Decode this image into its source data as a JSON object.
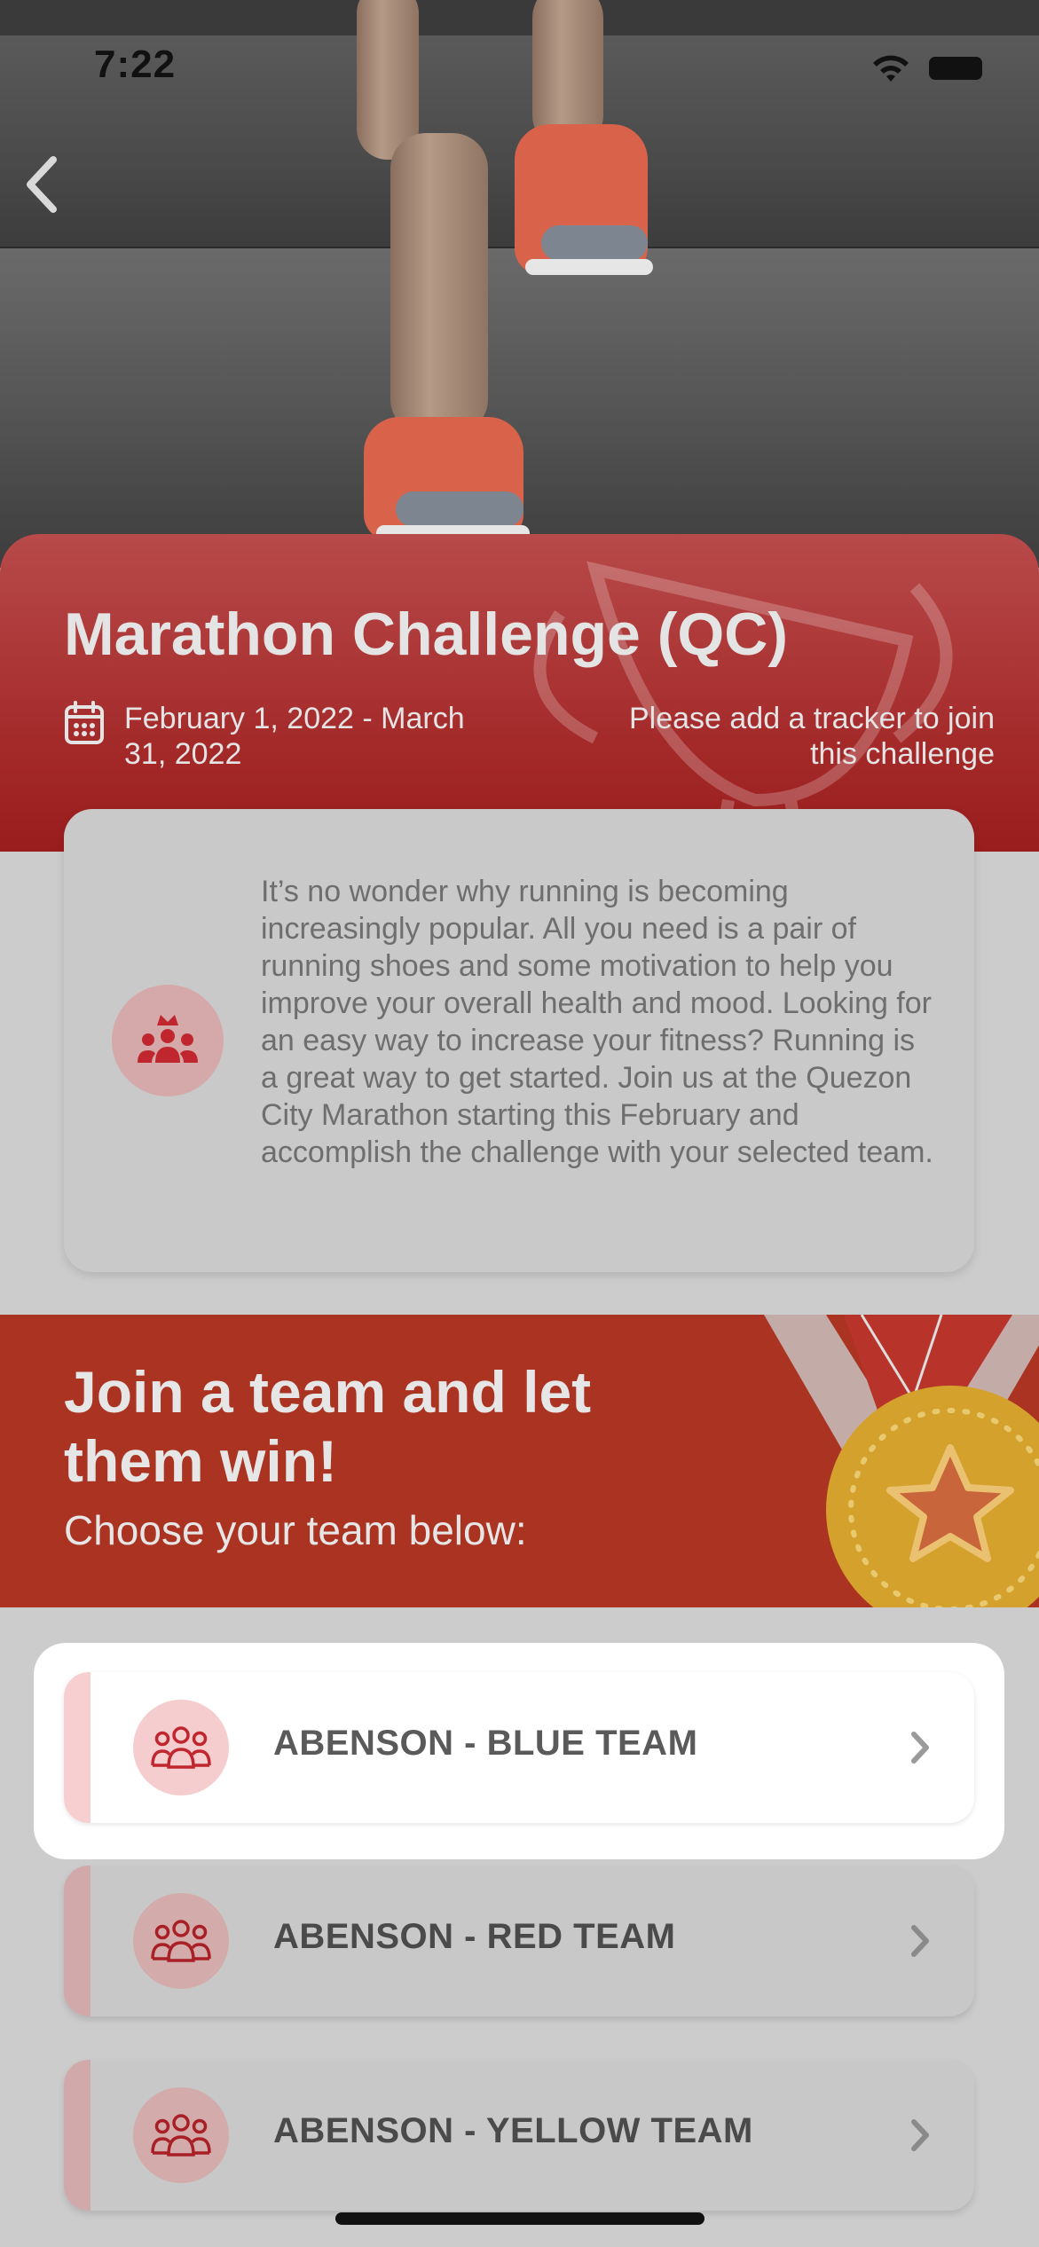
{
  "status_bar": {
    "time": "7:22"
  },
  "challenge": {
    "title": "Marathon Challenge (QC)",
    "date_range": "February 1, 2022 - March 31, 2022",
    "tracker_note": "Please add a tracker to join this challenge",
    "description": "It’s no wonder why running is becoming increasingly popular. All you need is a pair of running shoes and some motivation to help you improve your overall health and mood. Looking for an easy way to increase your fitness? Running is a great way to get started. Join us at the Quezon City Marathon starting this February and accomplish the challenge with your selected team."
  },
  "join": {
    "heading": "Join a team and let them win!",
    "subheading": "Choose your team below:"
  },
  "teams": [
    {
      "name": "ABENSON - BLUE TEAM",
      "selected": true
    },
    {
      "name": "ABENSON - RED TEAM",
      "selected": false
    },
    {
      "name": "ABENSON - YELLOW TEAM",
      "selected": false
    }
  ],
  "colors": {
    "brand_red": "#a32828",
    "banner_red": "#aa3322",
    "icon_red": "#c0262d",
    "medal_gold": "#d4a22c"
  },
  "icons": [
    "back-chevron-icon",
    "wifi-icon",
    "battery-icon",
    "calendar-icon",
    "crown-group-icon",
    "team-group-icon",
    "chevron-right-icon",
    "trophy-icon",
    "medal-icon"
  ]
}
